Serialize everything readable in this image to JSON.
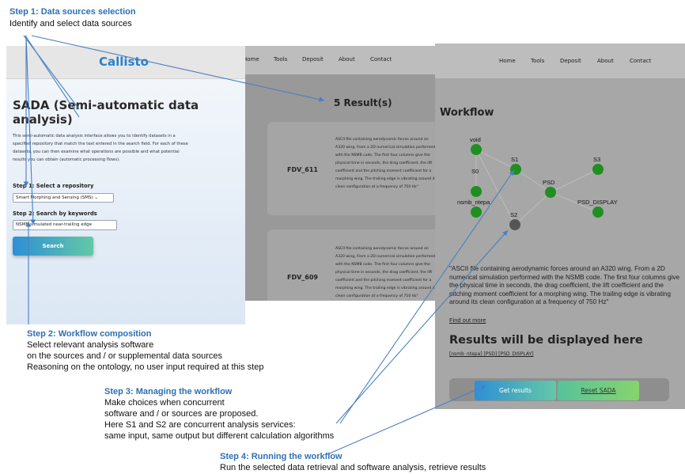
{
  "annotations": {
    "step1": {
      "title": "Step 1: Data sources selection",
      "lines": [
        "Identify and select data sources"
      ]
    },
    "step2": {
      "title": "Step 2: Workflow composition",
      "lines": [
        "Select relevant analysis software",
        "on the sources and / or supplemental data sources",
        "Reasoning on the ontology, no user input required at this step"
      ]
    },
    "step3": {
      "title": "Step 3: Managing the workflow",
      "lines": [
        "Make choices when concurrent",
        "software and / or sources are proposed.",
        "Here S1 and S2 are concurrent analysis services:",
        "same input, same output but different calculation algorithms"
      ]
    },
    "step4": {
      "title": "Step 4: Running the workflow",
      "lines": [
        "Run the selected data retrieval and software analysis, retrieve results"
      ]
    }
  },
  "panel1": {
    "logo": "Callisto",
    "title": "SADA (Semi-automatic data analysis)",
    "description": "This semi-automatic data analysis interface allows you to identify datasets in a specified repository that match the text entered in the search field. For each of these datasets, you can then examine what operations are possible and what potential results you can obtain (automatic processing flows).",
    "step1_label": "Step 1: Select a repository",
    "repository_value": "Smart Morphing and Sensing (SMS) ⌄",
    "step2_label": "Step 2: Search by keywords",
    "keywords_value": "NSMB-simulated near-trailing edge",
    "search_button": "Search"
  },
  "nav": [
    "Home",
    "Tools",
    "Deposit",
    "About",
    "Contact"
  ],
  "panel2": {
    "results_title": "5 Result(s)",
    "cards": [
      {
        "id": "FDV_611",
        "text": "ASCII file containing aerodynamic forces around an A320 wing. From a 2D numerical simulation performed with the NSMB code. The first four columns give the physical time in seconds, the drag coefficient, the lift coefficient and the pitching moment coefficient for a morphing wing. The trailing edge is vibrating around its clean configuration at a frequency of 750 Hz\""
      },
      {
        "id": "FDV_609",
        "text": "ASCII file containing aerodynamic forces around an A320 wing. From a 2D numerical simulation performed with the NSMB code. The first four columns give the physical time in seconds, the drag coefficient, the lift coefficient and the pitching moment coefficient for a morphing wing. The trailing edge is vibrating around its clean configuration at a frequency of 710 Hz\""
      }
    ]
  },
  "panel3": {
    "workflow_title": "Workflow",
    "nodes": [
      {
        "id": "void",
        "label": "void",
        "color": "#1f8f1f"
      },
      {
        "id": "S0",
        "label": "S0",
        "color": "#1f8f1f"
      },
      {
        "id": "S1",
        "label": "S1",
        "color": "#1f8f1f"
      },
      {
        "id": "S3",
        "label": "S3",
        "color": "#1f8f1f"
      },
      {
        "id": "PSD",
        "label": "PSD",
        "color": "#1f8f1f"
      },
      {
        "id": "nsmb_ntepa",
        "label": "nsmb_ntepa",
        "color": "#1f8f1f"
      },
      {
        "id": "PSD_DISPLAY",
        "label": "PSD_DISPLAY",
        "color": "#1f8f1f"
      },
      {
        "id": "S2",
        "label": "S2",
        "color": "#555555"
      }
    ],
    "quote": "\"ASCII file containing aerodynamic forces around an A320 wing. From a 2D numerical simulation performed with the NSMB code. The first four columns give the physical time in seconds, the drag coefficient, the lift coefficient and the pitching moment coefficient for a morphing wing. The trailing edge is vibrating around its clean configuration at a frequency of 750 Hz\"",
    "find_out_more": "Find out more",
    "results_title": "Results will be displayed here",
    "results_links": "[nsmb_ntepa] [PSD] [PSD_DISPLAY]",
    "get_results_button": "Get results",
    "reset_button": "Reset SADA"
  },
  "colors": {
    "step_title": "#2e6fb3",
    "arrow": "#4a7fc1",
    "node_green": "#1f8f1f",
    "node_gray": "#555555",
    "button_gradient_start": "#2f8fd6",
    "button_gradient_end": "#63c8a6"
  }
}
